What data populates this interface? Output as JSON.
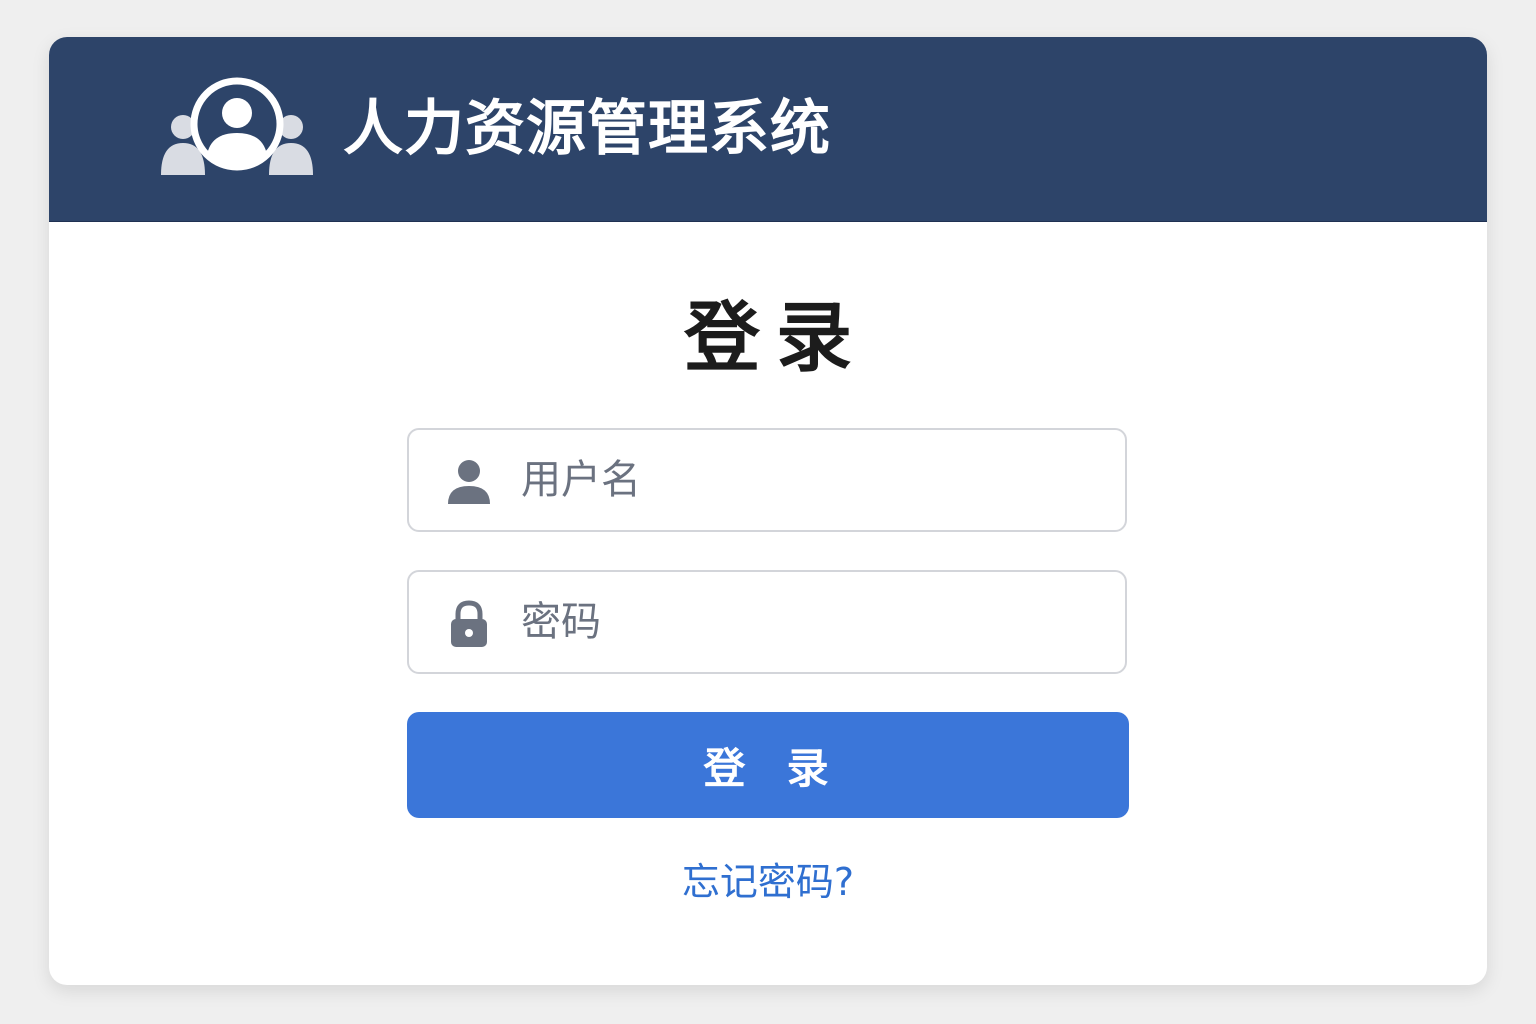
{
  "app": {
    "title": "人力资源管理系统",
    "logo_icon": "users-group-icon"
  },
  "login": {
    "title": "登录",
    "username_placeholder": "用户名",
    "username_icon": "user-icon",
    "password_placeholder": "密码",
    "password_icon": "lock-icon",
    "submit_label": "登  录",
    "forgot_label": "忘记密码?"
  },
  "colors": {
    "header_bg": "#2d4469",
    "primary": "#3b76d9",
    "link": "#2f6fd0",
    "icon": "#6b7280"
  }
}
